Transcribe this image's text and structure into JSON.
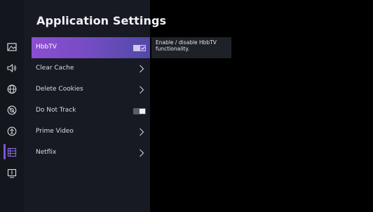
{
  "panel": {
    "title": "Application Settings",
    "items": [
      {
        "label": "HbbTV",
        "control": "toggle",
        "state": "on",
        "active": true
      },
      {
        "label": "Clear Cache",
        "control": "chevron"
      },
      {
        "label": "Delete Cookies",
        "control": "chevron"
      },
      {
        "label": "Do Not Track",
        "control": "toggle",
        "state": "off"
      },
      {
        "label": "Prime Video",
        "control": "chevron"
      },
      {
        "label": "Netflix",
        "control": "chevron"
      }
    ]
  },
  "tooltip": {
    "text": "Enable / disable HbbTV functionality."
  },
  "rail": {
    "icons": [
      "picture-icon",
      "sound-icon",
      "network-icon",
      "privacy-icon",
      "accessibility-icon",
      "applications-icon",
      "system-info-icon"
    ],
    "active": "applications-icon"
  },
  "colors": {
    "accent": "#7b55d4",
    "panel_bg": "#181a23",
    "rail_bg": "#14161d",
    "highlight_start": "#8a4fd0",
    "highlight_end": "#4f4aa6"
  }
}
